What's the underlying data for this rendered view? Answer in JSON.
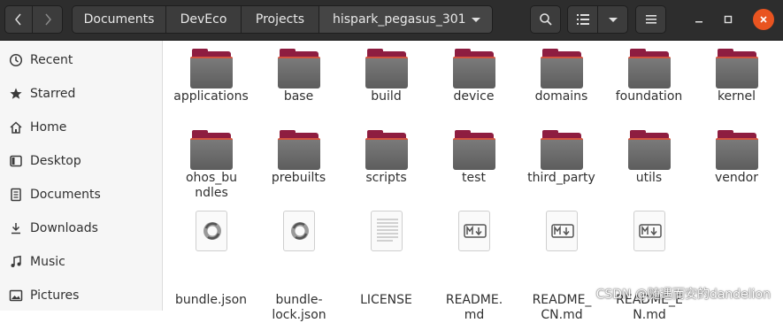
{
  "header": {
    "breadcrumbs": [
      "Documents",
      "DevEco",
      "Projects",
      "hispark_pegasus_301"
    ]
  },
  "sidebar": {
    "items": [
      {
        "label": "Recent",
        "icon": "clock-icon"
      },
      {
        "label": "Starred",
        "icon": "star-icon"
      },
      {
        "label": "Home",
        "icon": "home-icon"
      },
      {
        "label": "Desktop",
        "icon": "desktop-icon"
      },
      {
        "label": "Documents",
        "icon": "document-icon"
      },
      {
        "label": "Downloads",
        "icon": "download-icon"
      },
      {
        "label": "Music",
        "icon": "music-icon"
      },
      {
        "label": "Pictures",
        "icon": "pictures-icon"
      }
    ]
  },
  "files": {
    "row1": [
      "applications",
      "base",
      "build",
      "device",
      "domains",
      "foundation",
      "kernel"
    ],
    "row2": [
      "ohos_bundles",
      "prebuilts",
      "scripts",
      "test",
      "third_party",
      "utils",
      "vendor"
    ],
    "row3": [
      "bundle.json",
      "bundle-lock.json",
      "LICENSE",
      "README.md",
      "README_CN.md",
      "README_EN.md"
    ]
  },
  "watermark": "CSDN @随遇而安的dandelion",
  "colors": {
    "folder_back": "#8e1d40",
    "folder_front": "#6a6a6a",
    "folder_accent": "#d2543f",
    "close_button": "#e95420",
    "header_bg": "#2d2d2d",
    "sidebar_bg": "#f6f6f6"
  }
}
